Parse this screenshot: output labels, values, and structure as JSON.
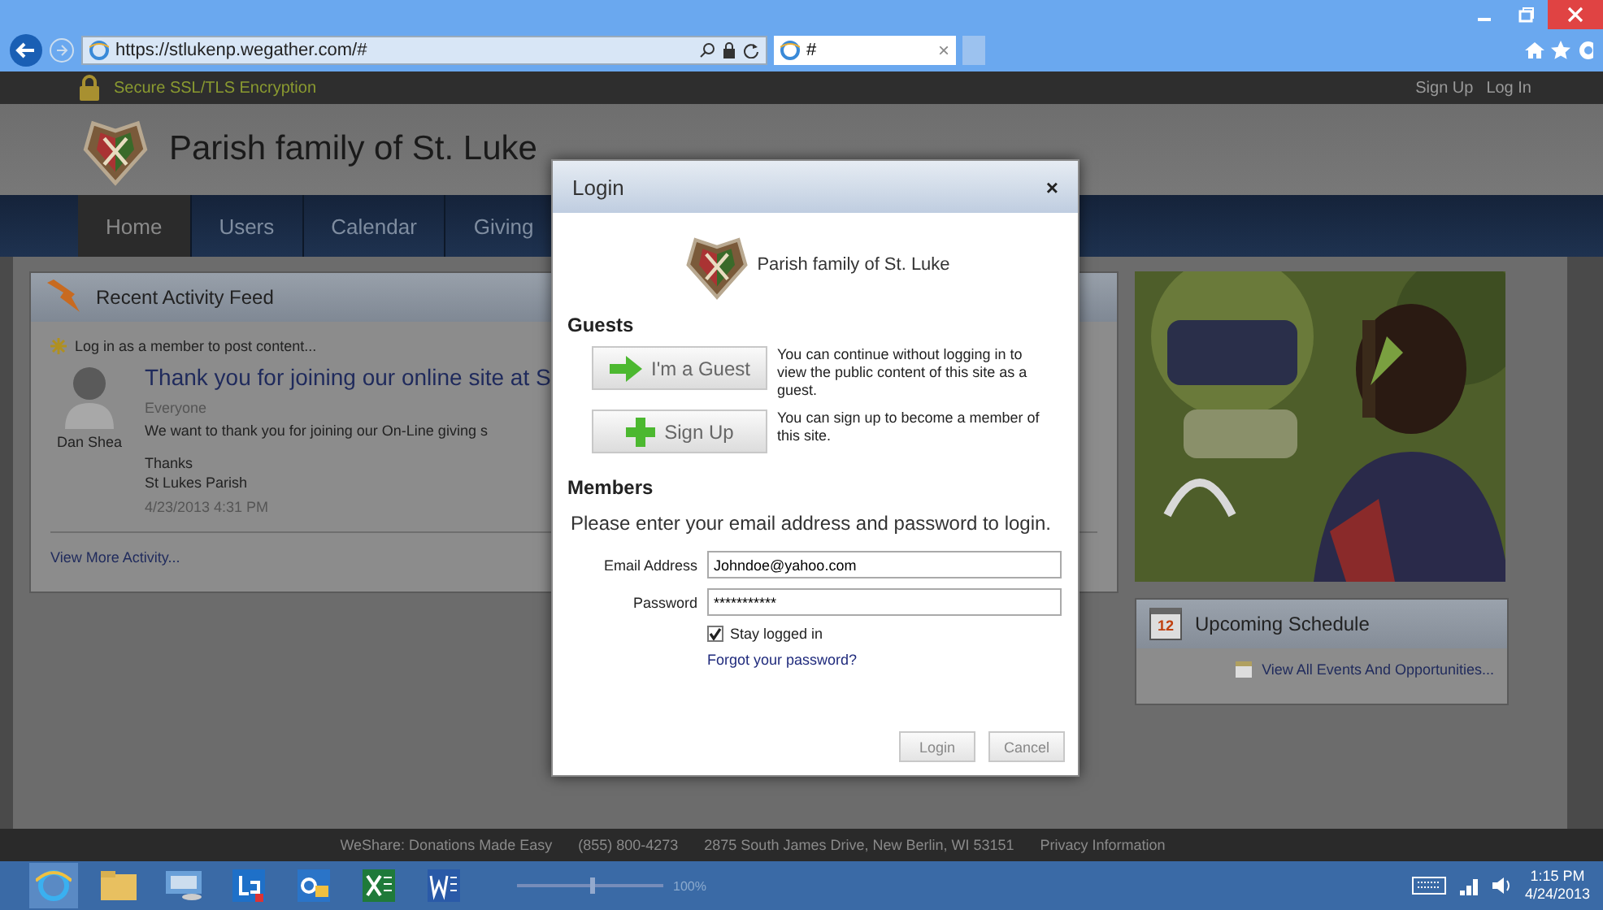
{
  "browser": {
    "address": "https://stlukenp.wegather.com/#",
    "tab": {
      "title": "#",
      "close": "×"
    }
  },
  "site_bar": {
    "security": "Secure SSL/TLS Encryption",
    "links": [
      "Sign Up",
      "Log In"
    ]
  },
  "header": {
    "title": "Parish family of St. Luke"
  },
  "nav": [
    {
      "label": "Home",
      "selected": true
    },
    {
      "label": "Users",
      "selected": false
    },
    {
      "label": "Calendar",
      "selected": false
    },
    {
      "label": "Giving",
      "selected": false
    }
  ],
  "activity_feed": {
    "title": "Recent Activity Feed",
    "prompt": "Log in as a member to post content...",
    "post": {
      "author": "Dan Shea",
      "title": "Thank you for joining our online site at S",
      "audience": "Everyone",
      "body": "We want to thank you for joining our On-Line giving s",
      "closing": [
        "Thanks",
        "St Lukes Parish"
      ],
      "time": "4/23/2013 4:31 PM"
    },
    "more": "View More Activity..."
  },
  "schedule": {
    "title": "Upcoming Schedule",
    "calendar_day": "12",
    "link": "View All Events And Opportunities..."
  },
  "footer": [
    "WeShare: Donations Made Easy",
    "(855) 800-4273",
    "2875 South James Drive, New Berlin, WI 53151",
    "Privacy Information"
  ],
  "login_dialog": {
    "title": "Login",
    "close": "×",
    "brand": "Parish family of St. Luke",
    "guests_heading": "Guests",
    "options": [
      {
        "kind": "arrow",
        "label": "I'm a Guest",
        "description": "You can continue without logging in to view the public content of this site as a guest."
      },
      {
        "kind": "plus",
        "label": "Sign Up",
        "description": "You can sign up to become a member of this site."
      }
    ],
    "members_heading": "Members",
    "instructions": "Please enter your email address and password to login.",
    "fields": [
      {
        "label": "Email Address",
        "value": "Johndoe@yahoo.com"
      },
      {
        "label": "Password",
        "value": "***********"
      }
    ],
    "stay_logged_in": {
      "label": "Stay logged in",
      "checked": true
    },
    "forgot_link": "Forgot your password?",
    "buttons": [
      "Login",
      "Cancel"
    ]
  },
  "taskbar": {
    "zoom": {
      "level": 0.5,
      "reading": "100%"
    },
    "time": "1:15 PM",
    "date": "4/24/2013"
  }
}
